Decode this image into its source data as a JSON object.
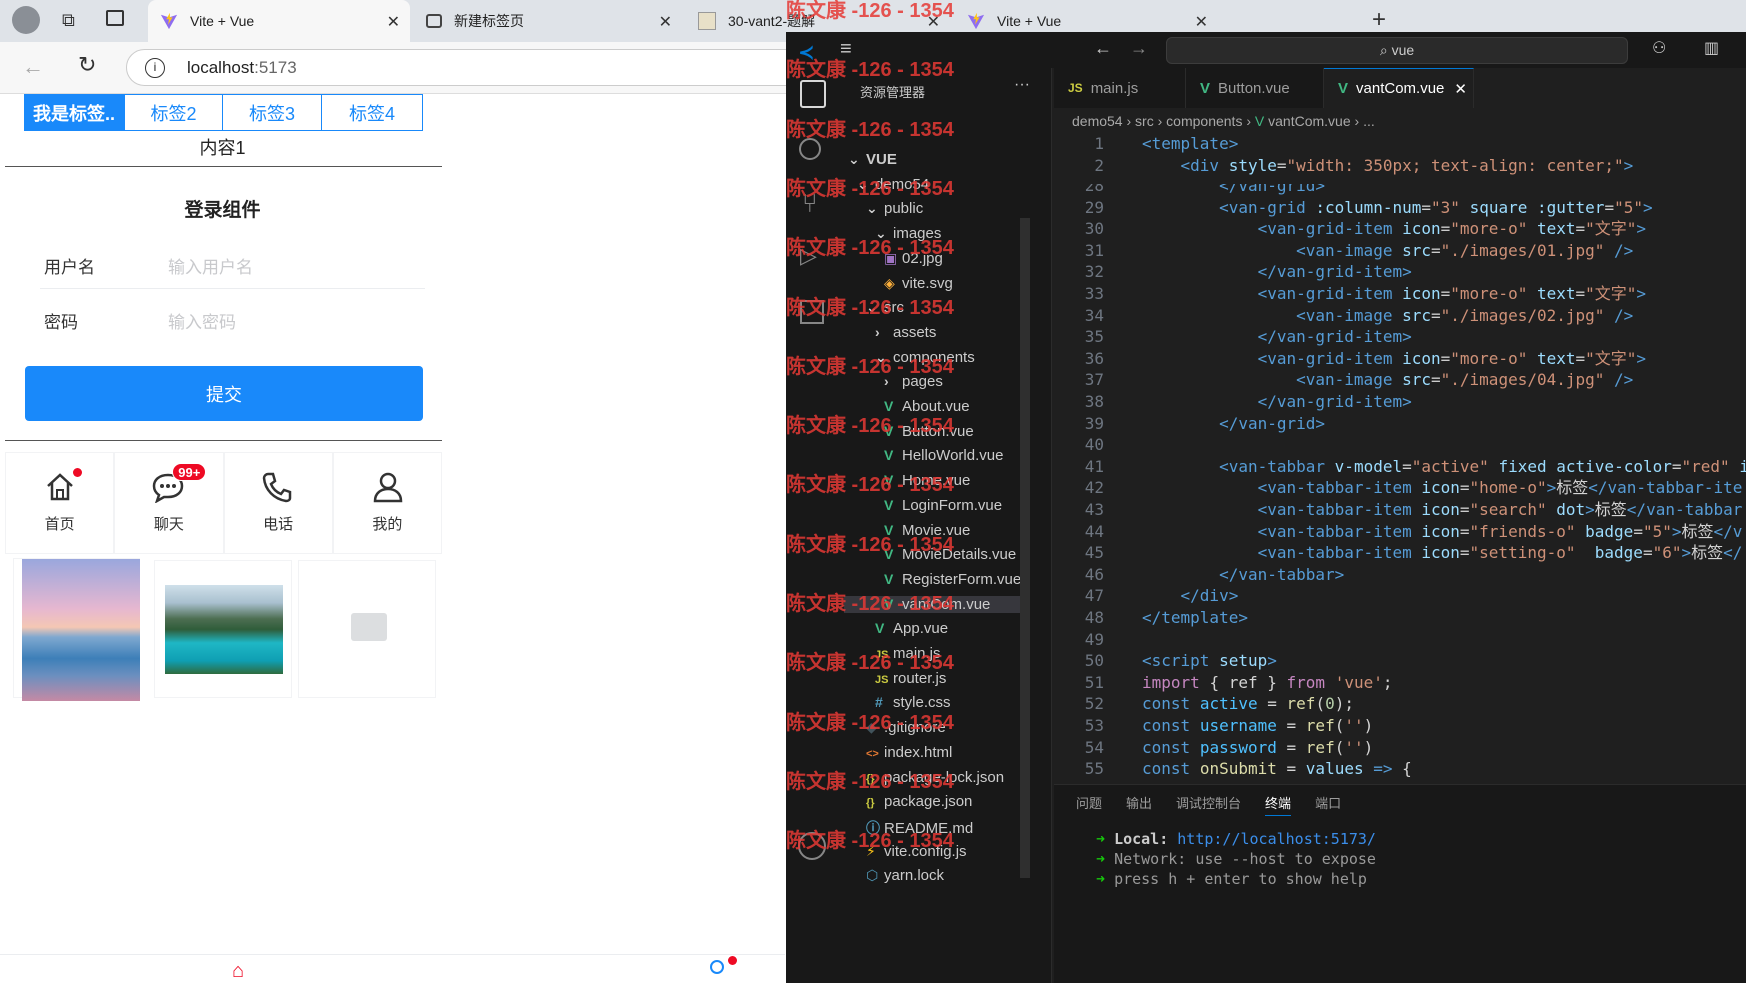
{
  "browser": {
    "tabs": [
      {
        "title": "Vite + Vue"
      },
      {
        "title": "新建标签页"
      },
      {
        "title": "30-vant2-题解"
      },
      {
        "title": "Vite + Vue"
      }
    ],
    "address": "localhost",
    "address_port": ":5173"
  },
  "app": {
    "tabs": [
      "我是标签..",
      "标签2",
      "标签3",
      "标签4"
    ],
    "content": "内容1",
    "login_title": "登录组件",
    "username_label": "用户名",
    "username_placeholder": "输入用户名",
    "password_label": "密码",
    "password_placeholder": "输入密码",
    "submit": "提交",
    "grid": [
      {
        "label": "首页",
        "icon": "home-icon",
        "badge": "dot"
      },
      {
        "label": "聊天",
        "icon": "chat-icon",
        "badge": "99+"
      },
      {
        "label": "电话",
        "icon": "phone-icon",
        "badge": ""
      },
      {
        "label": "我的",
        "icon": "user-icon",
        "badge": ""
      }
    ]
  },
  "vscode": {
    "search": "vue",
    "explorer_title": "资源管理器",
    "tree": [
      {
        "label": "VUE",
        "indent": 0,
        "kind": "root"
      },
      {
        "label": "demo54",
        "indent": 1,
        "kind": "folder-open"
      },
      {
        "label": "public",
        "indent": 2,
        "kind": "folder-open"
      },
      {
        "label": "images",
        "indent": 3,
        "kind": "folder-open"
      },
      {
        "label": "02.jpg",
        "indent": 4,
        "kind": "image"
      },
      {
        "label": "vite.svg",
        "indent": 4,
        "kind": "svg"
      },
      {
        "label": "src",
        "indent": 2,
        "kind": "folder-open"
      },
      {
        "label": "assets",
        "indent": 3,
        "kind": "folder-closed"
      },
      {
        "label": "components",
        "indent": 3,
        "kind": "folder-open"
      },
      {
        "label": "pages",
        "indent": 4,
        "kind": "folder-closed"
      },
      {
        "label": "About.vue",
        "indent": 4,
        "kind": "vue"
      },
      {
        "label": "Button.vue",
        "indent": 4,
        "kind": "vue"
      },
      {
        "label": "HelloWorld.vue",
        "indent": 4,
        "kind": "vue"
      },
      {
        "label": "Home.vue",
        "indent": 4,
        "kind": "vue"
      },
      {
        "label": "LoginForm.vue",
        "indent": 4,
        "kind": "vue"
      },
      {
        "label": "Movie.vue",
        "indent": 4,
        "kind": "vue"
      },
      {
        "label": "MovieDetails.vue",
        "indent": 4,
        "kind": "vue"
      },
      {
        "label": "RegisterForm.vue",
        "indent": 4,
        "kind": "vue"
      },
      {
        "label": "vantCom.vue",
        "indent": 4,
        "kind": "vue"
      },
      {
        "label": "App.vue",
        "indent": 3,
        "kind": "vue"
      },
      {
        "label": "main.js",
        "indent": 3,
        "kind": "js"
      },
      {
        "label": "router.js",
        "indent": 3,
        "kind": "js"
      },
      {
        "label": "style.css",
        "indent": 3,
        "kind": "css"
      },
      {
        "label": ".gitignore",
        "indent": 2,
        "kind": "git"
      },
      {
        "label": "index.html",
        "indent": 2,
        "kind": "html"
      },
      {
        "label": "package-lock.json",
        "indent": 2,
        "kind": "json"
      },
      {
        "label": "package.json",
        "indent": 2,
        "kind": "json"
      },
      {
        "label": "README.md",
        "indent": 2,
        "kind": "info"
      },
      {
        "label": "vite.config.js",
        "indent": 2,
        "kind": "vite"
      },
      {
        "label": "yarn.lock",
        "indent": 2,
        "kind": "yarn"
      }
    ],
    "editor_tabs": [
      "main.js",
      "Button.vue",
      "vantCom.vue"
    ],
    "breadcrumb": [
      "demo54",
      "src",
      "components",
      "vantCom.vue",
      "..."
    ],
    "panel_tabs": [
      "问题",
      "输出",
      "调试控制台",
      "终端",
      "端口"
    ],
    "terminal": {
      "local_label": "Local:",
      "local_url": "http://localhost:5173/",
      "network_label": "Network:",
      "network_text": "use --host to expose",
      "help_text": "press h + enter to show help"
    },
    "watermark": "陈文康 -126 - 1354"
  },
  "colors": {
    "vant_blue": "#1989fa",
    "vscode_bg": "#1f1f1f",
    "accent": "#0078d4"
  }
}
